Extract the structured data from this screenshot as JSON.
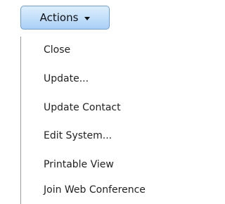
{
  "actions_button": {
    "label": "Actions"
  },
  "menu": {
    "items": [
      {
        "label": "Close"
      },
      {
        "label": "Update..."
      },
      {
        "label": "Update Contact"
      },
      {
        "label": "Edit System..."
      },
      {
        "label": "Printable View"
      },
      {
        "label": "Join Web Conference"
      }
    ]
  },
  "colors": {
    "button_gradient_top": "#dceefd",
    "button_gradient_bottom": "#a9d0f6",
    "button_border": "#6f9fd2",
    "menu_border": "#9a9a9a",
    "text": "#222222"
  },
  "icons": {
    "dropdown": "caret-down-icon"
  }
}
